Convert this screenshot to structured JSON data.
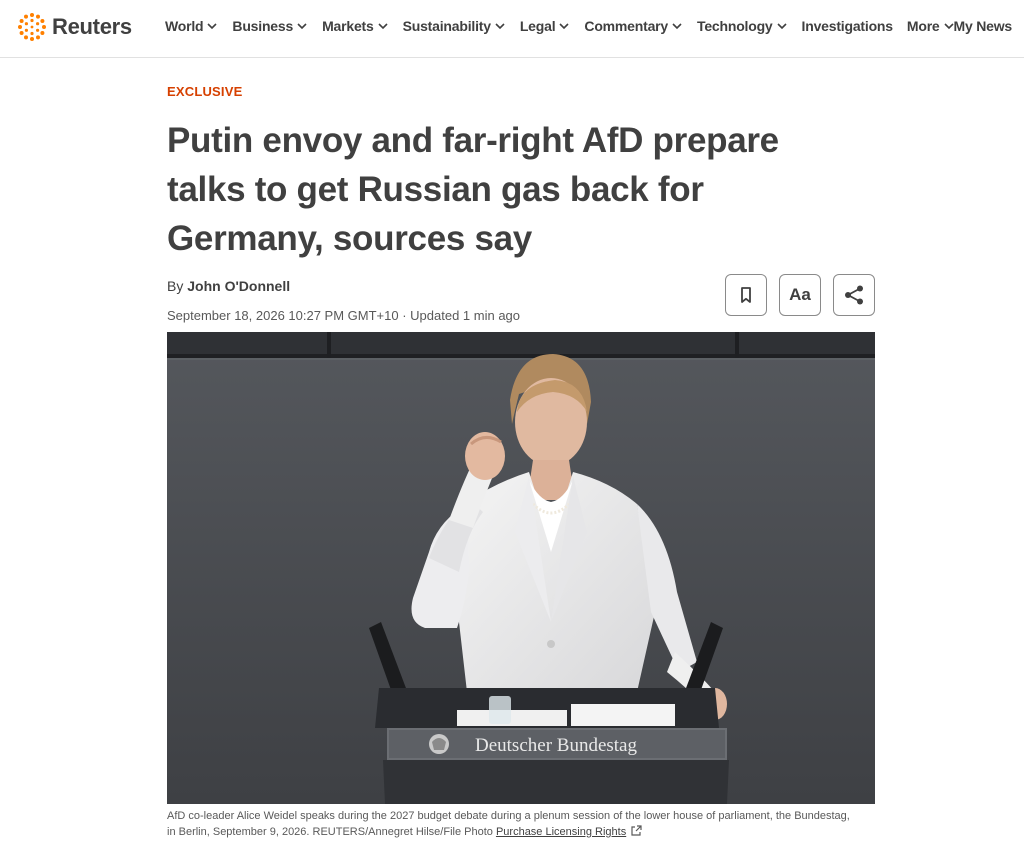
{
  "site": {
    "brand": "Reuters",
    "accent": "#ff8000"
  },
  "nav": {
    "items": [
      {
        "label": "World",
        "has_dropdown": true
      },
      {
        "label": "Business",
        "has_dropdown": true
      },
      {
        "label": "Markets",
        "has_dropdown": true
      },
      {
        "label": "Sustainability",
        "has_dropdown": true
      },
      {
        "label": "Legal",
        "has_dropdown": true
      },
      {
        "label": "Commentary",
        "has_dropdown": true
      },
      {
        "label": "Technology",
        "has_dropdown": true
      },
      {
        "label": "Investigations",
        "has_dropdown": false
      },
      {
        "label": "More",
        "has_dropdown": true
      }
    ],
    "my_news": "My News"
  },
  "article": {
    "kicker": "Exclusive",
    "kicker_color": "#d64000",
    "headline": "Putin envoy and far-right AfD prepare talks to get Russian gas back for Germany, sources say",
    "byline_prefix": "By",
    "author": "John O'Donnell",
    "dateline": "September 18, 2026 10:27 PM GMT+10 · Updated 1 min ago",
    "tools": {
      "bookmark_icon": "bookmark-icon",
      "font_size_label": "Aa",
      "share_icon": "share-icon"
    }
  },
  "photo": {
    "podium_sign": "Deutscher Bundestag",
    "caption_line1": "AfD co-leader Alice Weidel speaks during the 2027 budget debate during a plenum session of the lower house of parliament, the Bundestag,",
    "caption_line2": "in Berlin, September 9, 2026. REUTERS/Annegret Hilse/File Photo",
    "licensing_link": "Purchase Licensing Rights",
    "licensing_icon": "external-link-icon"
  }
}
